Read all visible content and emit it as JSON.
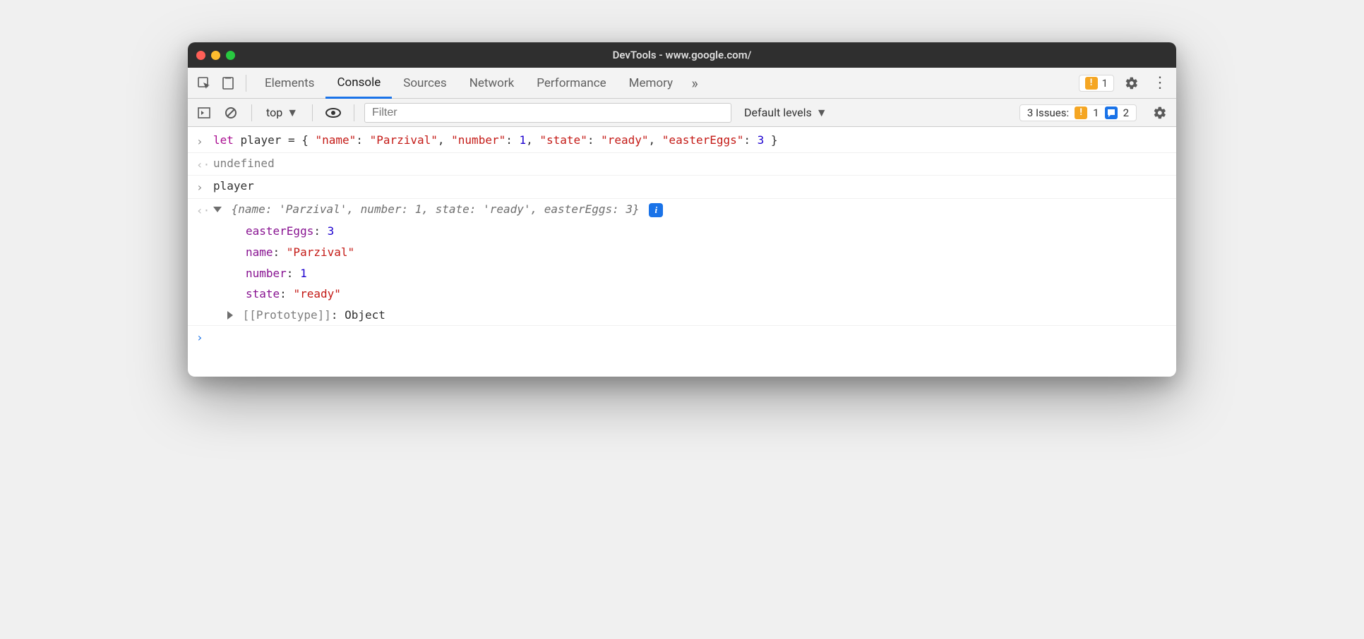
{
  "window": {
    "title": "DevTools - www.google.com/"
  },
  "tabs": {
    "items": [
      "Elements",
      "Console",
      "Sources",
      "Network",
      "Performance",
      "Memory"
    ],
    "active": "Console"
  },
  "topRight": {
    "warning_count": "1"
  },
  "toolbar": {
    "context": "top",
    "filter_placeholder": "Filter",
    "levels": "Default levels",
    "issues_label": "3 Issues:",
    "issues_warn": "1",
    "issues_info": "2"
  },
  "console": {
    "input1_kw": "let",
    "input1_var": " player = { ",
    "input1_k1": "\"name\"",
    "input1_v1": "\"Parzival\"",
    "input1_k2": "\"number\"",
    "input1_v2": "1",
    "input1_k3": "\"state\"",
    "input1_v3": "\"ready\"",
    "input1_k4": "\"easterEggs\"",
    "input1_v4": "3",
    "sep": ": ",
    "comma": ", ",
    "close": " }",
    "result1": "undefined",
    "input2": "player",
    "summary_open": "{",
    "summary_k1": "name",
    "summary_v1": "'Parzival'",
    "summary_k2": "number",
    "summary_v2": "1",
    "summary_k3": "state",
    "summary_v3": "'ready'",
    "summary_k4": "easterEggs",
    "summary_v4": "3",
    "summary_close": "}",
    "prop1_k": "easterEggs",
    "prop1_v": "3",
    "prop2_k": "name",
    "prop2_v": "\"Parzival\"",
    "prop3_k": "number",
    "prop3_v": "1",
    "prop4_k": "state",
    "prop4_v": "\"ready\"",
    "proto_k": "[[Prototype]]",
    "proto_v": "Object"
  }
}
